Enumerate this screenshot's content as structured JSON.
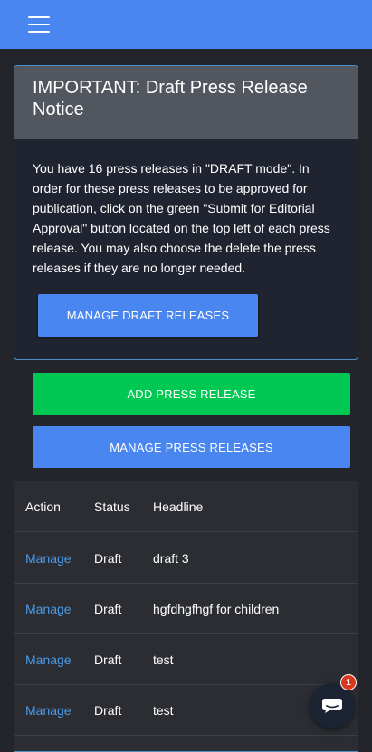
{
  "topbar": {
    "menu_icon": "hamburger-menu-icon",
    "color": "#4a86f0"
  },
  "notice": {
    "title": "IMPORTANT: Draft Press Release Notice",
    "body": "You have 16 press releases in \"DRAFT mode\". In order for these press releases to be approved for publication, click on the green \"Submit for Editorial Approval\" button located on the top left of each press release. You may also choose the delete the press releases if they are no longer needed.",
    "button_label": "MANAGE DRAFT RELEASES"
  },
  "actions": {
    "add_label": "ADD PRESS RELEASE",
    "manage_label": "MANAGE PRESS RELEASES"
  },
  "table": {
    "columns": [
      "Action",
      "Status",
      "Headline"
    ],
    "rows": [
      {
        "action": "Manage",
        "status": "Draft",
        "headline": "draft 3"
      },
      {
        "action": "Manage",
        "status": "Draft",
        "headline": "hgfdhgfhgf for children"
      },
      {
        "action": "Manage",
        "status": "Draft",
        "headline": "test"
      },
      {
        "action": "Manage",
        "status": "Draft",
        "headline": "test"
      }
    ]
  },
  "chat": {
    "icon": "chat-bubble-icon",
    "badge_count": "1"
  },
  "colors": {
    "primary": "#4a86f0",
    "success": "#00c853",
    "link": "#4a9be8",
    "badge": "#d9381e"
  }
}
